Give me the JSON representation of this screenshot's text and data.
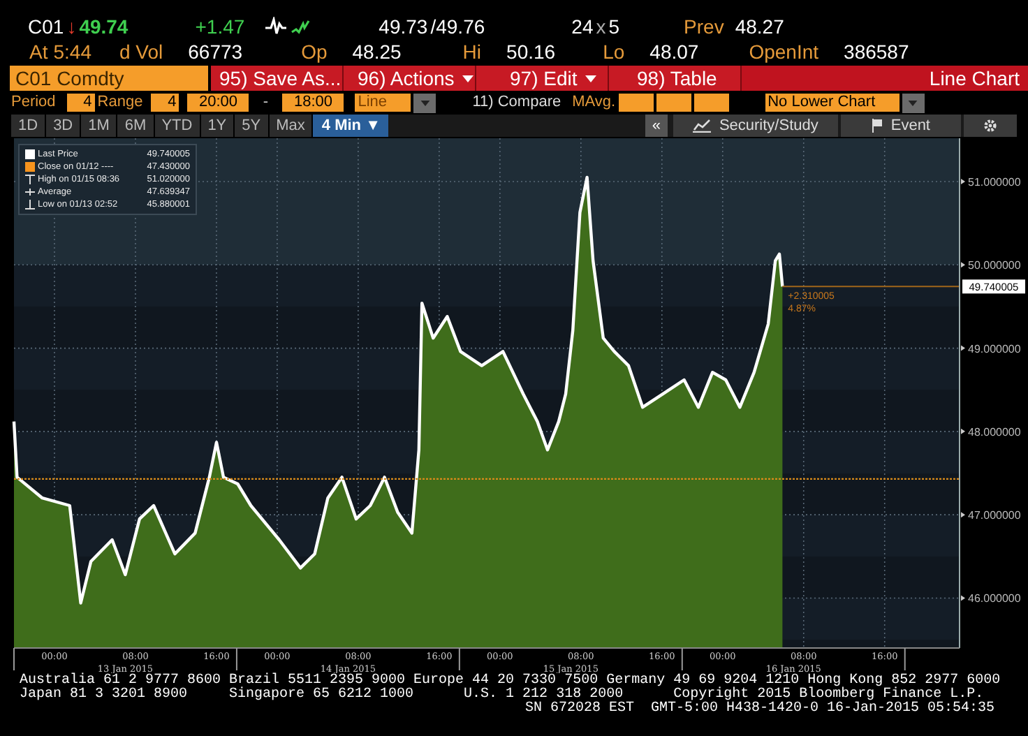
{
  "quote": {
    "ticker": "C01",
    "arrow": "↓",
    "last": "49.74",
    "change": "+1.47",
    "bid": "49.73",
    "ask": "/49.76",
    "size_bid": "24",
    "size_x": "x",
    "size_ask": "5",
    "prev_label": "Prev",
    "prev": "48.27"
  },
  "quote_row2": [
    {
      "label": "At",
      "value": "5:44",
      "kind": "time"
    },
    {
      "label": "d Vol",
      "value": "66773"
    },
    {
      "label": "Op",
      "value": "48.25"
    },
    {
      "label": "Hi",
      "value": "50.16"
    },
    {
      "label": "Lo",
      "value": "48.07"
    },
    {
      "label": "OpenInt",
      "value": "386587"
    }
  ],
  "menu": {
    "security": "C01 Comdty",
    "buttons": [
      {
        "label": "95) Save As...",
        "caret": false
      },
      {
        "label": "96) Actions",
        "caret": true
      },
      {
        "label": "97) Edit",
        "caret": true
      },
      {
        "label": "98) Table",
        "caret": false
      }
    ],
    "title": "Line Chart"
  },
  "settings": {
    "period_label": "Period",
    "period": "4",
    "range_label": "Range",
    "range": "4",
    "start": "20:00",
    "dash": "-",
    "end": "18:00",
    "style": "Line",
    "compare": "11) Compare",
    "mavg_label": "MAvg.",
    "lower_chart": "No Lower Chart"
  },
  "tabs": [
    {
      "label": "1D",
      "selected": false
    },
    {
      "label": "3D",
      "selected": false
    },
    {
      "label": "1M",
      "selected": false
    },
    {
      "label": "6M",
      "selected": false
    },
    {
      "label": "YTD",
      "selected": false
    },
    {
      "label": "1Y",
      "selected": false
    },
    {
      "label": "5Y",
      "selected": false
    },
    {
      "label": "Max",
      "selected": false
    },
    {
      "label": "4 Min ▼",
      "selected": true
    }
  ],
  "toolbar": {
    "collapse": "«",
    "study": "Security/Study",
    "event": "Event"
  },
  "legend": [
    {
      "kind": "series",
      "value": "49.740005"
    },
    {
      "kind": "square",
      "color": "#f7941d",
      "label": "Close on 01/12 ----",
      "value": "47.430000"
    },
    {
      "kind": "high",
      "label": "High on 01/15 08:36",
      "value": "51.020000"
    },
    {
      "kind": "average",
      "label": "Average",
      "value": "47.639347"
    },
    {
      "kind": "low",
      "label": "Low on 01/13 02:52",
      "value": "45.880001"
    }
  ],
  "chart": {
    "date_labels": [
      "13 Jan 2015",
      "14 Jan 2015",
      "15 Jan 2015",
      "16 Jan 2015"
    ],
    "time_labels": [
      "00:00",
      "08:00",
      "16:00",
      "00:00",
      "08:00",
      "16:00",
      "00:00",
      "08:00",
      "16:00"
    ],
    "chart_data": {
      "type": "area",
      "grid": true,
      "xlim": [
        -4,
        89.4
      ],
      "ylim": [
        45.4,
        51.52
      ],
      "x": [
        -4,
        -3.7,
        -1.2,
        1.5,
        2.6,
        3.6,
        5.7,
        7,
        8.4,
        9.8,
        11.9,
        13.9,
        15.3,
        16,
        16.7,
        18.1,
        19.4,
        22.2,
        24.3,
        25.7,
        27,
        28.4,
        29.8,
        31.2,
        32.6,
        33.9,
        35.3,
        36,
        36.3,
        37.4,
        38.8,
        40.1,
        42.2,
        44.3,
        46.3,
        47.7,
        48.7,
        49.8,
        50.5,
        51.2,
        51.9,
        52.6,
        53.2,
        54.2,
        55.3,
        56.7,
        58.1,
        60.1,
        62.2,
        63.6,
        65,
        66.3,
        67.7,
        69.1,
        70.5,
        71.2,
        71.6,
        71.9
      ],
      "xticks": [
        {
          "value": 0,
          "label": "00:00"
        },
        {
          "value": 8,
          "label": "08:00"
        },
        {
          "value": 16,
          "label": "16:00"
        }
      ],
      "series": [
        {
          "name": "Last Price",
          "color": "#ffffff",
          "values": [
            48.12,
            47.45,
            47.2,
            47.11,
            45.94,
            46.44,
            46.7,
            46.28,
            46.95,
            47.11,
            46.53,
            46.78,
            47.45,
            47.87,
            47.45,
            47.37,
            47.11,
            46.7,
            46.36,
            46.53,
            47.2,
            47.45,
            46.95,
            47.11,
            47.45,
            47.03,
            46.78,
            47.78,
            49.54,
            49.12,
            49.38,
            48.96,
            48.79,
            48.96,
            48.45,
            48.12,
            47.78,
            48.12,
            48.45,
            49.21,
            50.63,
            51.05,
            50.05,
            49.12,
            48.96,
            48.79,
            48.29,
            48.45,
            48.62,
            48.29,
            48.71,
            48.62,
            48.29,
            48.71,
            49.29,
            50.05,
            50.13,
            49.74
          ]
        }
      ],
      "yticks": [
        {
          "value": 46,
          "label": "46.000000"
        },
        {
          "value": 47,
          "label": "47.000000"
        },
        {
          "value": 48,
          "label": "48.000000"
        },
        {
          "value": 49,
          "label": "49.000000"
        },
        {
          "value": 50,
          "label": "50.000000"
        },
        {
          "value": 51,
          "label": "51.000000"
        }
      ],
      "ref_lines": [
        {
          "axis": "y",
          "value": 47.43,
          "color": "#d98a1a"
        }
      ],
      "annotations": [
        {
          "text": "49.740005"
        },
        {
          "text": "+2.310005"
        },
        {
          "text": "4.87%"
        }
      ]
    }
  },
  "footer": [
    "Australia 61 2 9777 8600 Brazil 5511 2395 9000 Europe 44 20 7330 7500 Germany 49 69 9204 1210 Hong Kong 852 2977 6000",
    "Japan 81 3 3201 8900     Singapore 65 6212 1000      U.S. 1 212 318 2000      Copyright 2015 Bloomberg Finance L.P.",
    "SN 672028 EST  GMT-5:00 H438-1420-0 16-Jan-2015 05:54:35"
  ]
}
